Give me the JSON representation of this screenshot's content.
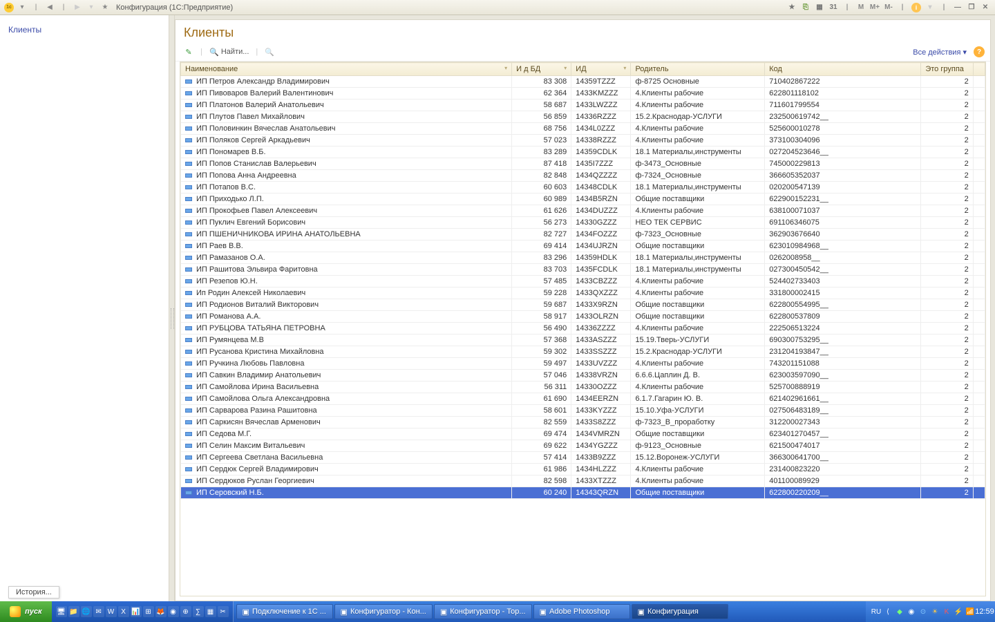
{
  "window": {
    "title": "Конфигурация  (1С:Предприятие)"
  },
  "title_right": {
    "m": "M",
    "mplus": "M+",
    "mminus": "M-"
  },
  "left": {
    "title": "Клиенты"
  },
  "main": {
    "heading": "Клиенты",
    "find_label": "Найти...",
    "all_actions": "Все действия ▾"
  },
  "columns": {
    "name": "Наименование",
    "id_bd": "И д БД",
    "id": "ИД",
    "parent": "Родитель",
    "code": "Код",
    "is_group": "Это группа"
  },
  "rows": [
    {
      "name": "ИП Петров Александр Владимирович",
      "idbd": "83 308",
      "id": "14359TZZZ",
      "parent": "ф-8725 Основные",
      "code": "710402867222",
      "grp": "2"
    },
    {
      "name": "ИП Пивоваров Валерий Валентинович",
      "idbd": "62 364",
      "id": "1433KMZZZ",
      "parent": "4.Клиенты рабочие",
      "code": "622801118102",
      "grp": "2"
    },
    {
      "name": "ИП Платонов Валерий Анатольевич",
      "idbd": "58 687",
      "id": "1433LWZZZ",
      "parent": "4.Клиенты рабочие",
      "code": "711601799554",
      "grp": "2"
    },
    {
      "name": "ИП Плутов Павел Михайлович",
      "idbd": "56 859",
      "id": "14336RZZZ",
      "parent": "15.2.Краснодар-УСЛУГИ",
      "code": "232500619742__",
      "grp": "2"
    },
    {
      "name": "ИП Половинкин Вячеслав Анатольевич",
      "idbd": "68 756",
      "id": "1434L0ZZZ",
      "parent": "4.Клиенты рабочие",
      "code": "525600010278",
      "grp": "2"
    },
    {
      "name": "ИП Поляков Сергей Аркадьевич",
      "idbd": "57 023",
      "id": "14338RZZZ",
      "parent": "4.Клиенты рабочие",
      "code": "373100304096",
      "grp": "2"
    },
    {
      "name": "ИП Пономарев В.Б.",
      "idbd": "83 289",
      "id": "14359CDLK",
      "parent": "18.1 Материалы,инструменты",
      "code": "027204523646__",
      "grp": "2"
    },
    {
      "name": "ИП Попов Станислав Валерьевич",
      "idbd": "87 418",
      "id": "1435I7ZZZ",
      "parent": "ф-3473_Основные",
      "code": "745000229813",
      "grp": "2"
    },
    {
      "name": "ИП Попова Анна Андреевна",
      "idbd": "82 848",
      "id": "1434QZZZZ",
      "parent": "ф-7324_Основные",
      "code": "366605352037",
      "grp": "2"
    },
    {
      "name": "ИП Потапов В.С.",
      "idbd": "60 603",
      "id": "14348CDLK",
      "parent": "18.1 Материалы,инструменты",
      "code": "020200547139",
      "grp": "2"
    },
    {
      "name": "ИП Приходько Л.П.",
      "idbd": "60 989",
      "id": "1434B5RZN",
      "parent": "Общие поставщики",
      "code": "622900152231__",
      "grp": "2"
    },
    {
      "name": "ИП Прокофьев Павел Алексеевич",
      "idbd": "61 626",
      "id": "1434DUZZZ",
      "parent": "4.Клиенты рабочие",
      "code": "638100071037",
      "grp": "2"
    },
    {
      "name": "ИП Пуклич Евгений Борисович",
      "idbd": "56 273",
      "id": "14330GZZZ",
      "parent": "НЕО ТЕК СЕРВИС",
      "code": "691106346075",
      "grp": "2"
    },
    {
      "name": "ИП ПШЕНИЧНИКОВА ИРИНА АНАТОЛЬЕВНА",
      "idbd": "82 727",
      "id": "1434FOZZZ",
      "parent": "ф-7323_Основные",
      "code": "362903676640",
      "grp": "2"
    },
    {
      "name": "ИП Раев В.В.",
      "idbd": "69 414",
      "id": "1434UJRZN",
      "parent": "Общие поставщики",
      "code": "623010984968__",
      "grp": "2"
    },
    {
      "name": "ИП Рамазанов О.А.",
      "idbd": "83 296",
      "id": "14359HDLK",
      "parent": "18.1 Материалы,инструменты",
      "code": "0262008958__",
      "grp": "2"
    },
    {
      "name": "ИП Рашитова Эльвира Фаритовна",
      "idbd": "83 703",
      "id": "1435FCDLK",
      "parent": "18.1 Материалы,инструменты",
      "code": "027300450542__",
      "grp": "2"
    },
    {
      "name": "ИП Резепов Ю.Н.",
      "idbd": "57 485",
      "id": "1433CBZZZ",
      "parent": "4.Клиенты рабочие",
      "code": "524402733403",
      "grp": "2"
    },
    {
      "name": "Ип Родин Алексей Николаевич",
      "idbd": "59 228",
      "id": "1433QXZZZ",
      "parent": "4.Клиенты рабочие",
      "code": "331800002415",
      "grp": "2"
    },
    {
      "name": "ИП Родионов Виталий Викторович",
      "idbd": "59 687",
      "id": "1433X9RZN",
      "parent": "Общие поставщики",
      "code": "622800554995__",
      "grp": "2"
    },
    {
      "name": "ИП Романова А.А.",
      "idbd": "58 917",
      "id": "1433OLRZN",
      "parent": "Общие поставщики",
      "code": "622800537809",
      "grp": "2"
    },
    {
      "name": "ИП РУБЦОВА ТАТЬЯНА ПЕТРОВНА",
      "idbd": "56 490",
      "id": "14336ZZZZ",
      "parent": "4.Клиенты рабочие",
      "code": "222506513224",
      "grp": "2"
    },
    {
      "name": "ИП Румянцева М.В",
      "idbd": "57 368",
      "id": "1433ASZZZ",
      "parent": "15.19.Тверь-УСЛУГИ",
      "code": "690300753295__",
      "grp": "2"
    },
    {
      "name": "ИП Русанова Кристина Михайловна",
      "idbd": "59 302",
      "id": "1433SSZZZ",
      "parent": "15.2.Краснодар-УСЛУГИ",
      "code": "231204193847__",
      "grp": "2"
    },
    {
      "name": "ИП Ручкина Любовь Павловна",
      "idbd": "59 497",
      "id": "1433UVZZZ",
      "parent": "4.Клиенты рабочие",
      "code": "743201151088",
      "grp": "2"
    },
    {
      "name": "ИП Савкин Владимир Анатольевич",
      "idbd": "57 046",
      "id": "14338VRZN",
      "parent": "6.6.6.Цаплин Д. В.",
      "code": "623003597090__",
      "grp": "2"
    },
    {
      "name": "ИП Самойлова Ирина Васильевна",
      "idbd": "56 311",
      "id": "14330OZZZ",
      "parent": "4.Клиенты рабочие",
      "code": "525700888919",
      "grp": "2"
    },
    {
      "name": "ИП Самойлова Ольга Александровна",
      "idbd": "61 690",
      "id": "1434EERZN",
      "parent": "6.1.7.Гагарин Ю. В.",
      "code": "621402961661__",
      "grp": "2"
    },
    {
      "name": "ИП Сарварова Разина Рашитовна",
      "idbd": "58 601",
      "id": "1433KYZZZ",
      "parent": "15.10.Уфа-УСЛУГИ",
      "code": "027506483189__",
      "grp": "2"
    },
    {
      "name": "ИП Саркисян Вячеслав Арменович",
      "idbd": "82 559",
      "id": "1433S8ZZZ",
      "parent": "ф-7323_В_проработку",
      "code": "312200027343",
      "grp": "2"
    },
    {
      "name": "ИП Седова М.Г.",
      "idbd": "69 474",
      "id": "1434VMRZN",
      "parent": "Общие поставщики",
      "code": "623401270457__",
      "grp": "2"
    },
    {
      "name": "ИП Селин Максим Витальевич",
      "idbd": "69 622",
      "id": "1434YGZZZ",
      "parent": "ф-9123_Основные",
      "code": "621500474017",
      "grp": "2"
    },
    {
      "name": "ИП Сергеева Светлана Васильевна",
      "idbd": "57 414",
      "id": "1433B9ZZZ",
      "parent": "15.12.Воронеж-УСЛУГИ",
      "code": "366300641700__",
      "grp": "2"
    },
    {
      "name": "ИП Сердюк Сергей Владимирович",
      "idbd": "61 986",
      "id": "1434HLZZZ",
      "parent": "4.Клиенты рабочие",
      "code": "231400823220",
      "grp": "2"
    },
    {
      "name": "ИП Сердюков Руслан Георгиевич",
      "idbd": "82 598",
      "id": "1433XTZZZ",
      "parent": "4.Клиенты рабочие",
      "code": "401100089929",
      "grp": "2"
    },
    {
      "name": "ИП Серовский Н.Б.",
      "idbd": "60 240",
      "id": "14343QRZN",
      "parent": "Общие поставщики",
      "code": "622800220209__",
      "grp": "2",
      "selected": true
    }
  ],
  "history_btn": "История...",
  "taskbar": {
    "start": "пуск",
    "tasks": [
      {
        "label": "Подключение к 1С ..."
      },
      {
        "label": "Конфигуратор - Кон..."
      },
      {
        "label": "Конфигуратор - Тор..."
      },
      {
        "label": "Adobe Photoshop"
      },
      {
        "label": "Конфигурация",
        "active": true
      }
    ],
    "lang": "RU",
    "clock": "12:59"
  }
}
